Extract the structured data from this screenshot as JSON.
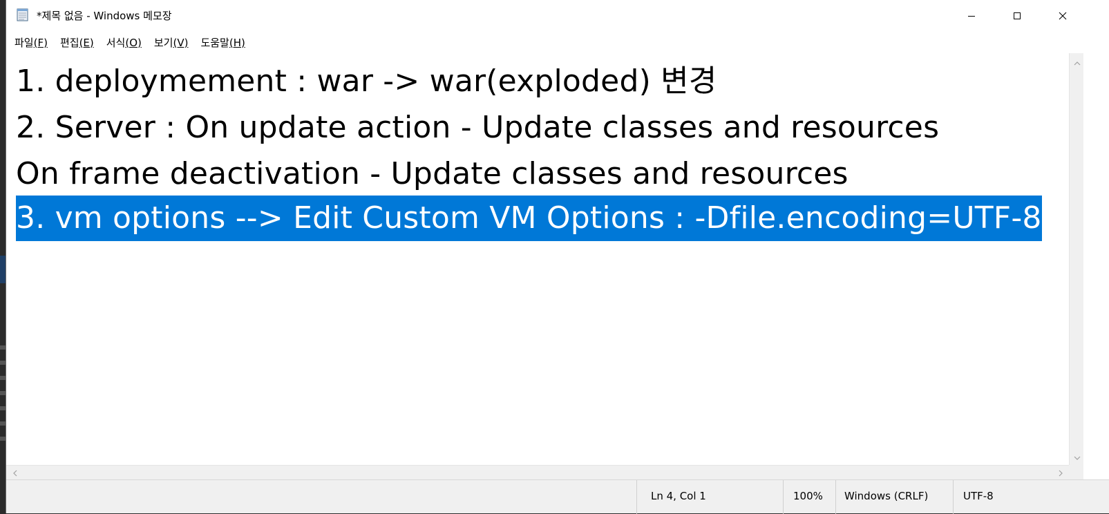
{
  "window": {
    "title": "*제목 없음 - Windows 메모장",
    "icon": "notepad-icon",
    "controls": {
      "minimize": "minimize-icon",
      "maximize": "maximize-icon",
      "close": "close-icon"
    }
  },
  "menu": [
    {
      "label": "파일",
      "accel": "(F)",
      "accel_underlined": "F"
    },
    {
      "label": "편집",
      "accel": "(E)",
      "accel_underlined": "E"
    },
    {
      "label": "서식",
      "accel": "(O)",
      "accel_underlined": "O"
    },
    {
      "label": "보기",
      "accel": "(V)",
      "accel_underlined": "V"
    },
    {
      "label": "도움말",
      "accel": "(H)",
      "accel_underlined": "H"
    }
  ],
  "editor": {
    "lines": [
      "1. deploymement : war -> war(exploded) 변경",
      "2. Server : On update action - Update classes and resources",
      "On frame deactivation - Update classes and resources",
      "3. vm options --> Edit Custom VM Options : -Dfile.encoding=UTF-8"
    ],
    "selected_line_index": 3,
    "selection_color": "#0078d7"
  },
  "status": {
    "position": "Ln 4, Col 1",
    "zoom": "100%",
    "line_ending": "Windows (CRLF)",
    "encoding": "UTF-8"
  }
}
